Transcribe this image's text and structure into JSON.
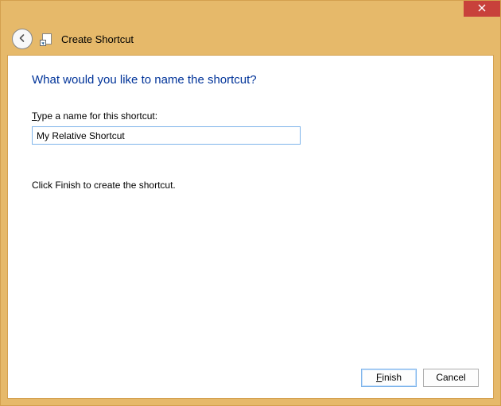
{
  "window": {
    "title": "Create Shortcut"
  },
  "main": {
    "heading": "What would you like to name the shortcut?",
    "field_label_pre": "T",
    "field_label_rest": "ype a name for this shortcut:",
    "input_value": "My Relative Shortcut",
    "hint": "Click Finish to create the shortcut."
  },
  "buttons": {
    "finish_pre": "F",
    "finish_rest": "inish",
    "cancel": "Cancel"
  }
}
